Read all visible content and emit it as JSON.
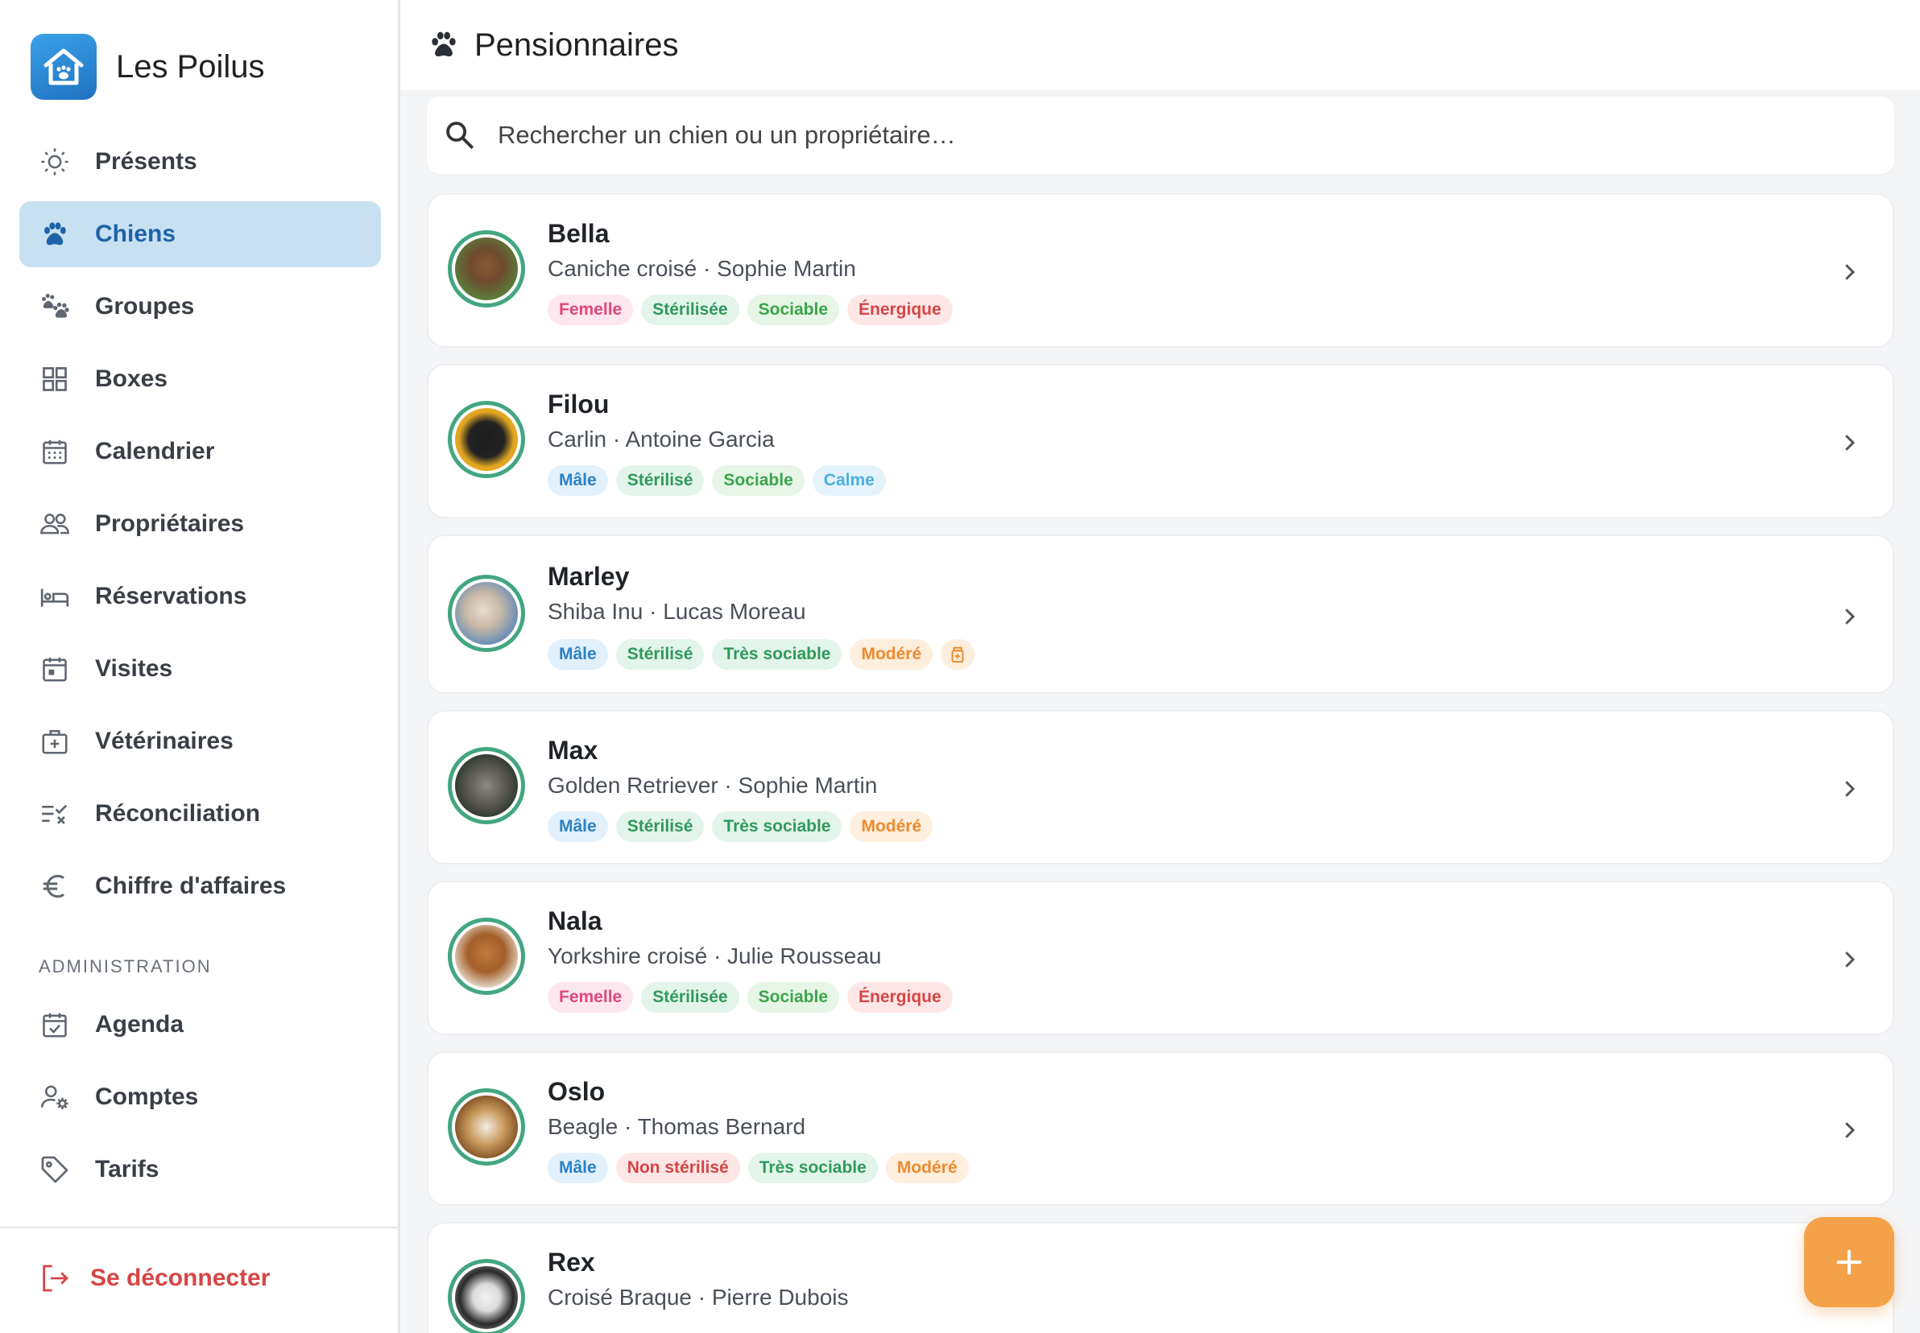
{
  "brand": {
    "name": "Les Poilus"
  },
  "nav": [
    {
      "label": "Présents",
      "icon": "sun-icon",
      "active": false
    },
    {
      "label": "Chiens",
      "icon": "paw-icon",
      "active": true
    },
    {
      "label": "Groupes",
      "icon": "paws-icon",
      "active": false
    },
    {
      "label": "Boxes",
      "icon": "grid-icon",
      "active": false
    },
    {
      "label": "Calendrier",
      "icon": "calendar-icon",
      "active": false
    },
    {
      "label": "Propriétaires",
      "icon": "people-icon",
      "active": false
    },
    {
      "label": "Réservations",
      "icon": "bed-icon",
      "active": false
    },
    {
      "label": "Visites",
      "icon": "calendar-day-icon",
      "active": false
    },
    {
      "label": "Vétérinaires",
      "icon": "medical-case-icon",
      "active": false
    },
    {
      "label": "Réconciliation",
      "icon": "checklist-icon",
      "active": false
    },
    {
      "label": "Chiffre d'affaires",
      "icon": "euro-icon",
      "active": false
    }
  ],
  "admin": {
    "title": "ADMINISTRATION",
    "items": [
      {
        "label": "Agenda",
        "icon": "calendar-check-icon"
      },
      {
        "label": "Comptes",
        "icon": "user-settings-icon"
      },
      {
        "label": "Tarifs",
        "icon": "tag-icon"
      }
    ]
  },
  "logout": {
    "label": "Se déconnecter",
    "color": "#d64545"
  },
  "header": {
    "title": "Pensionnaires"
  },
  "search": {
    "placeholder": "Rechercher un chien ou un propriétaire…",
    "value": ""
  },
  "colors": {
    "accent": "#1e63a8",
    "active_bg": "#c8e1f2",
    "fab": "#f4a24a",
    "avatar_ring": "#42a680"
  },
  "dogs": [
    {
      "name": "Bella",
      "meta": "Caniche croisé · Sophie Martin",
      "tags": [
        {
          "label": "Femelle",
          "style": "pink"
        },
        {
          "label": "Stérilisée",
          "style": "green"
        },
        {
          "label": "Sociable",
          "style": "lime"
        },
        {
          "label": "Énergique",
          "style": "red"
        }
      ]
    },
    {
      "name": "Filou",
      "meta": "Carlin · Antoine Garcia",
      "tags": [
        {
          "label": "Mâle",
          "style": "blue"
        },
        {
          "label": "Stérilisé",
          "style": "green"
        },
        {
          "label": "Sociable",
          "style": "lime"
        },
        {
          "label": "Calme",
          "style": "sky"
        }
      ]
    },
    {
      "name": "Marley",
      "meta": "Shiba Inu · Lucas Moreau",
      "tags": [
        {
          "label": "Mâle",
          "style": "blue"
        },
        {
          "label": "Stérilisé",
          "style": "green"
        },
        {
          "label": "Très sociable",
          "style": "green"
        },
        {
          "label": "Modéré",
          "style": "orange"
        },
        {
          "label": "",
          "style": "icon",
          "icon": "medication-icon"
        }
      ]
    },
    {
      "name": "Max",
      "meta": "Golden Retriever · Sophie Martin",
      "tags": [
        {
          "label": "Mâle",
          "style": "blue"
        },
        {
          "label": "Stérilisé",
          "style": "green"
        },
        {
          "label": "Très sociable",
          "style": "green"
        },
        {
          "label": "Modéré",
          "style": "orange"
        }
      ]
    },
    {
      "name": "Nala",
      "meta": "Yorkshire croisé · Julie Rousseau",
      "tags": [
        {
          "label": "Femelle",
          "style": "pink"
        },
        {
          "label": "Stérilisée",
          "style": "green"
        },
        {
          "label": "Sociable",
          "style": "lime"
        },
        {
          "label": "Énergique",
          "style": "red"
        }
      ]
    },
    {
      "name": "Oslo",
      "meta": "Beagle · Thomas Bernard",
      "tags": [
        {
          "label": "Mâle",
          "style": "blue"
        },
        {
          "label": "Non stérilisé",
          "style": "red"
        },
        {
          "label": "Très sociable",
          "style": "green"
        },
        {
          "label": "Modéré",
          "style": "orange"
        }
      ]
    },
    {
      "name": "Rex",
      "meta": "Croisé Braque · Pierre Dubois",
      "tags": []
    }
  ]
}
